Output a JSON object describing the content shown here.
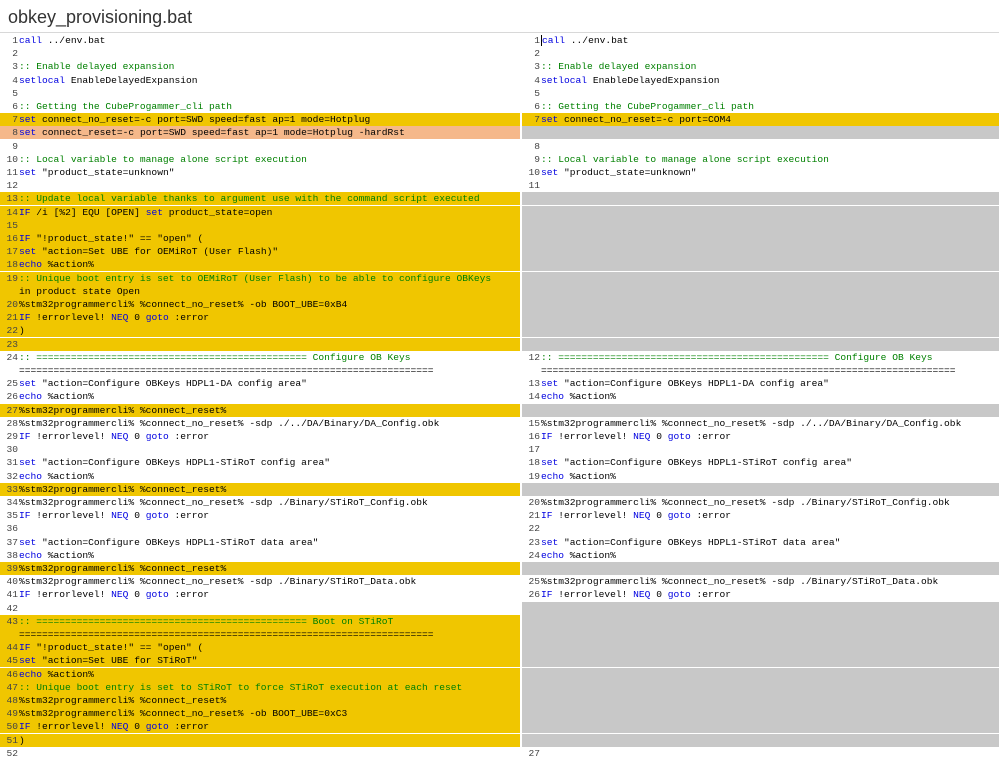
{
  "title": "obkey_provisioning.bat",
  "colors": {
    "changed": "#f0c600",
    "removed": "#f5b88a",
    "blank": "#c8c8c8",
    "keyword": "#0000e0",
    "comment": "#008000"
  },
  "left": [
    {
      "n": "1",
      "t": "call ../env.bat"
    },
    {
      "n": "2",
      "t": ""
    },
    {
      "n": "3",
      "t": ":: Enable delayed expansion"
    },
    {
      "n": "4",
      "t": "setlocal EnableDelayedExpansion"
    },
    {
      "n": "5",
      "t": ""
    },
    {
      "n": "6",
      "t": ":: Getting the CubeProgammer_cli path"
    },
    {
      "n": "7",
      "t": "set connect_no_reset=-c port=SWD speed=fast ap=1 mode=Hotplug",
      "s": "changed"
    },
    {
      "n": "8",
      "t": "set connect_reset=-c port=SWD speed=fast ap=1 mode=Hotplug -hardRst",
      "s": "removed"
    },
    {
      "n": "9",
      "t": ""
    },
    {
      "n": "10",
      "t": ":: Local variable to manage alone script execution"
    },
    {
      "n": "11",
      "t": "set \"product_state=unknown\""
    },
    {
      "n": "12",
      "t": ""
    },
    {
      "n": "13",
      "t": ":: Update local variable thanks to argument use with the command script executed",
      "s": "changed"
    },
    {
      "n": "14",
      "t": "IF /i [%2] EQU [OPEN] set product_state=open",
      "s": "changed"
    },
    {
      "n": "15",
      "t": "",
      "s": "changed"
    },
    {
      "n": "16",
      "t": "IF \"!product_state!\" == \"open\" (",
      "s": "changed"
    },
    {
      "n": "17",
      "t": "set \"action=Set UBE for OEMiRoT (User Flash)\"",
      "s": "changed"
    },
    {
      "n": "18",
      "t": "echo %action%",
      "s": "changed"
    },
    {
      "n": "19",
      "t": ":: Unique boot entry is set to OEMiRoT (User Flash) to be able to configure OBKeys",
      "s": "changed"
    },
    {
      "n": "",
      "t": "in product state Open",
      "s": "changed"
    },
    {
      "n": "20",
      "t": "%stm32programmercli% %connect_no_reset% -ob BOOT_UBE=0xB4",
      "s": "changed"
    },
    {
      "n": "21",
      "t": "IF !errorlevel! NEQ 0 goto :error",
      "s": "changed"
    },
    {
      "n": "22",
      "t": ")",
      "s": "changed"
    },
    {
      "n": "23",
      "t": "",
      "s": "changed"
    },
    {
      "n": "24",
      "t": ":: =============================================== Configure OB Keys"
    },
    {
      "n": "",
      "t": "========================================================================"
    },
    {
      "n": "25",
      "t": "set \"action=Configure OBKeys HDPL1-DA config area\""
    },
    {
      "n": "26",
      "t": "echo %action%"
    },
    {
      "n": "27",
      "t": "%stm32programmercli% %connect_reset%",
      "s": "changed"
    },
    {
      "n": "28",
      "t": "%stm32programmercli% %connect_no_reset% -sdp ./../DA/Binary/DA_Config.obk"
    },
    {
      "n": "29",
      "t": "IF !errorlevel! NEQ 0 goto :error"
    },
    {
      "n": "30",
      "t": ""
    },
    {
      "n": "31",
      "t": "set \"action=Configure OBKeys HDPL1-STiRoT config area\""
    },
    {
      "n": "32",
      "t": "echo %action%"
    },
    {
      "n": "33",
      "t": "%stm32programmercli% %connect_reset%",
      "s": "changed"
    },
    {
      "n": "34",
      "t": "%stm32programmercli% %connect_no_reset% -sdp ./Binary/STiRoT_Config.obk"
    },
    {
      "n": "35",
      "t": "IF !errorlevel! NEQ 0 goto :error"
    },
    {
      "n": "36",
      "t": ""
    },
    {
      "n": "37",
      "t": "set \"action=Configure OBKeys HDPL1-STiRoT data area\""
    },
    {
      "n": "38",
      "t": "echo %action%"
    },
    {
      "n": "39",
      "t": "%stm32programmercli% %connect_reset%",
      "s": "changed"
    },
    {
      "n": "40",
      "t": "%stm32programmercli% %connect_no_reset% -sdp ./Binary/STiRoT_Data.obk"
    },
    {
      "n": "41",
      "t": "IF !errorlevel! NEQ 0 goto :error"
    },
    {
      "n": "42",
      "t": ""
    },
    {
      "n": "43",
      "t": ":: =============================================== Boot on STiRoT",
      "s": "changed"
    },
    {
      "n": "",
      "t": "========================================================================",
      "s": "changed"
    },
    {
      "n": "44",
      "t": "IF \"!product_state!\" == \"open\" (",
      "s": "changed"
    },
    {
      "n": "45",
      "t": "set \"action=Set UBE for STiRoT\"",
      "s": "changed"
    },
    {
      "n": "46",
      "t": "echo %action%",
      "s": "changed"
    },
    {
      "n": "47",
      "t": ":: Unique boot entry is set to STiRoT to force STiRoT execution at each reset",
      "s": "changed"
    },
    {
      "n": "48",
      "t": "%stm32programmercli% %connect_reset%",
      "s": "changed"
    },
    {
      "n": "49",
      "t": "%stm32programmercli% %connect_no_reset% -ob BOOT_UBE=0xC3",
      "s": "changed"
    },
    {
      "n": "50",
      "t": "IF !errorlevel! NEQ 0 goto :error",
      "s": "changed"
    },
    {
      "n": "51",
      "t": ")",
      "s": "changed"
    },
    {
      "n": "52",
      "t": ""
    }
  ],
  "right": [
    {
      "n": "1",
      "t": "call ../env.bat",
      "caret": true
    },
    {
      "n": "2",
      "t": ""
    },
    {
      "n": "3",
      "t": ":: Enable delayed expansion"
    },
    {
      "n": "4",
      "t": "setlocal EnableDelayedExpansion"
    },
    {
      "n": "5",
      "t": ""
    },
    {
      "n": "6",
      "t": ":: Getting the CubeProgammer_cli path"
    },
    {
      "n": "7",
      "t": "set connect_no_reset=-c port=COM4",
      "s": "changed"
    },
    {
      "n": "",
      "t": "",
      "s": "blank"
    },
    {
      "n": "8",
      "t": ""
    },
    {
      "n": "9",
      "t": ":: Local variable to manage alone script execution"
    },
    {
      "n": "10",
      "t": "set \"product_state=unknown\""
    },
    {
      "n": "11",
      "t": ""
    },
    {
      "n": "",
      "t": "",
      "s": "blank"
    },
    {
      "n": "",
      "t": "",
      "s": "blank"
    },
    {
      "n": "",
      "t": "",
      "s": "blank"
    },
    {
      "n": "",
      "t": "",
      "s": "blank"
    },
    {
      "n": "",
      "t": "",
      "s": "blank"
    },
    {
      "n": "",
      "t": "",
      "s": "blank"
    },
    {
      "n": "",
      "t": "",
      "s": "blank"
    },
    {
      "n": "",
      "t": "",
      "s": "blank"
    },
    {
      "n": "",
      "t": "",
      "s": "blank"
    },
    {
      "n": "",
      "t": "",
      "s": "blank"
    },
    {
      "n": "",
      "t": "",
      "s": "blank"
    },
    {
      "n": "",
      "t": "",
      "s": "blank"
    },
    {
      "n": "12",
      "t": ":: =============================================== Configure OB Keys"
    },
    {
      "n": "",
      "t": "========================================================================"
    },
    {
      "n": "13",
      "t": "set \"action=Configure OBKeys HDPL1-DA config area\""
    },
    {
      "n": "14",
      "t": "echo %action%"
    },
    {
      "n": "",
      "t": "",
      "s": "blank"
    },
    {
      "n": "15",
      "t": "%stm32programmercli% %connect_no_reset% -sdp ./../DA/Binary/DA_Config.obk"
    },
    {
      "n": "16",
      "t": "IF !errorlevel! NEQ 0 goto :error"
    },
    {
      "n": "17",
      "t": ""
    },
    {
      "n": "18",
      "t": "set \"action=Configure OBKeys HDPL1-STiRoT config area\""
    },
    {
      "n": "19",
      "t": "echo %action%"
    },
    {
      "n": "",
      "t": "",
      "s": "blank"
    },
    {
      "n": "20",
      "t": "%stm32programmercli% %connect_no_reset% -sdp ./Binary/STiRoT_Config.obk"
    },
    {
      "n": "21",
      "t": "IF !errorlevel! NEQ 0 goto :error"
    },
    {
      "n": "22",
      "t": ""
    },
    {
      "n": "23",
      "t": "set \"action=Configure OBKeys HDPL1-STiRoT data area\""
    },
    {
      "n": "24",
      "t": "echo %action%"
    },
    {
      "n": "",
      "t": "",
      "s": "blank"
    },
    {
      "n": "25",
      "t": "%stm32programmercli% %connect_no_reset% -sdp ./Binary/STiRoT_Data.obk"
    },
    {
      "n": "26",
      "t": "IF !errorlevel! NEQ 0 goto :error"
    },
    {
      "n": "",
      "t": "",
      "s": "blank"
    },
    {
      "n": "",
      "t": "",
      "s": "blank"
    },
    {
      "n": "",
      "t": "",
      "s": "blank"
    },
    {
      "n": "",
      "t": "",
      "s": "blank"
    },
    {
      "n": "",
      "t": "",
      "s": "blank"
    },
    {
      "n": "",
      "t": "",
      "s": "blank"
    },
    {
      "n": "",
      "t": "",
      "s": "blank"
    },
    {
      "n": "",
      "t": "",
      "s": "blank"
    },
    {
      "n": "",
      "t": "",
      "s": "blank"
    },
    {
      "n": "",
      "t": "",
      "s": "blank"
    },
    {
      "n": "",
      "t": "",
      "s": "blank"
    },
    {
      "n": "27",
      "t": ""
    }
  ]
}
